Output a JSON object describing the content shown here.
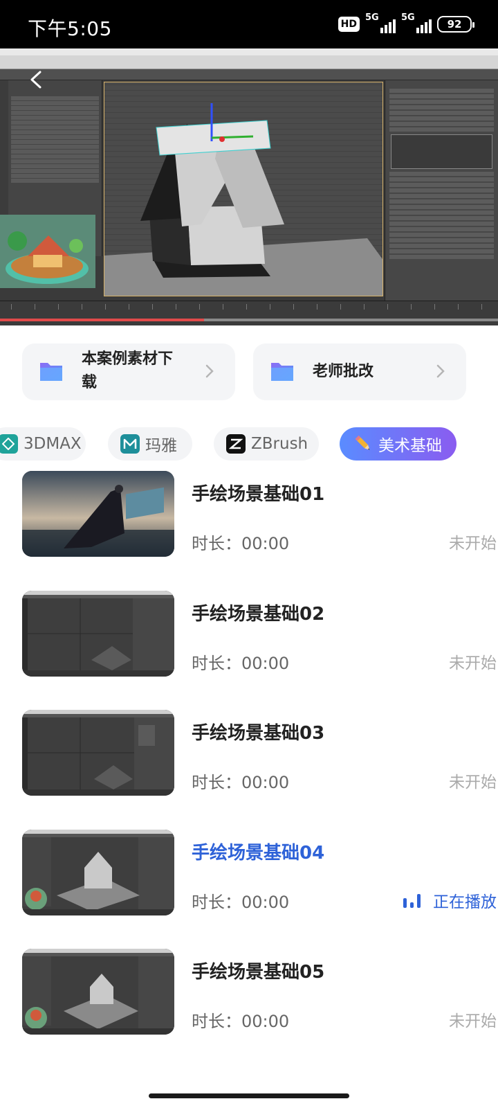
{
  "status_bar": {
    "time": "下午5:05",
    "hd": "HD",
    "sim1": "5G",
    "sim2": "5G",
    "battery": "92"
  },
  "player": {
    "progress_fraction": 0.41
  },
  "shortcuts": [
    {
      "label_line1": "本案例素材下",
      "label_line2": "载"
    },
    {
      "label": "老师批改"
    }
  ],
  "categories": [
    {
      "label": "3DMAX"
    },
    {
      "label": "玛雅"
    },
    {
      "label": "ZBrush"
    },
    {
      "label": "美术基础"
    }
  ],
  "lessons": [
    {
      "title": "手绘场景基础01",
      "duration": "时长：00:00",
      "status": "未开始"
    },
    {
      "title": "手绘场景基础02",
      "duration": "时长：00:00",
      "status": "未开始"
    },
    {
      "title": "手绘场景基础03",
      "duration": "时长：00:00",
      "status": "未开始"
    },
    {
      "title": "手绘场景基础04",
      "duration": "时长：00:00",
      "status": "正在播放"
    },
    {
      "title": "手绘场景基础05",
      "duration": "时长：00:00",
      "status": "未开始"
    }
  ],
  "colors": {
    "accent": "#2e62d8",
    "chip_active_from": "#5a8cff",
    "chip_active_to": "#8a5cf0",
    "progress": "#e24a4a"
  }
}
